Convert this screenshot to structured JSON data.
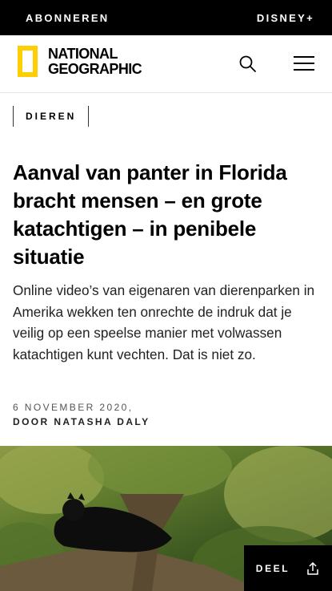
{
  "topbar": {
    "subscribe_label": "ABONNEREN",
    "disney_label": "DISNEY+"
  },
  "header": {
    "logo_line1": "NATIONAL",
    "logo_line2": "GEOGRAPHIC",
    "brand_color": "#ffce00"
  },
  "article": {
    "category": "DIEREN",
    "title": "Aanval van panter in Florida bracht mensen – en grote katachtigen – in penibele situatie",
    "dek": "Online video’s van eigenaren van dierenparken in Amerika wekken ten onrechte de indruk dat je veilig op een speelse manier met volwassen katachtigen kunt vechten. Dat is niet zo.",
    "date": "6 NOVEMBER 2020,",
    "byline": "DOOR NATASHA DALY"
  },
  "share": {
    "label": "DEEL"
  },
  "icons": [
    "search-icon",
    "menu-icon",
    "share-icon"
  ]
}
